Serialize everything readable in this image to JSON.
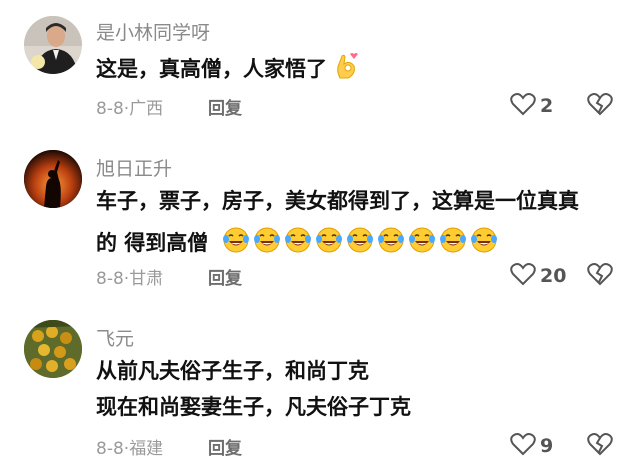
{
  "comments": [
    {
      "username": "是小林同学呀",
      "lines": [
        "这是，真高僧，人家悟了"
      ],
      "date": "8-8",
      "location": "广西",
      "reply_label": "回复",
      "likes": "2",
      "trailing_emoji": "ok-hand-emoji"
    },
    {
      "username": "旭日正升",
      "lines": [
        "车子，票子，房子，美女都得到了，这算是一位真真",
        "的 得到高僧"
      ],
      "date": "8-8",
      "location": "甘肃",
      "reply_label": "回复",
      "likes": "20",
      "trailing_emoji": "laughing-crying-emoji"
    },
    {
      "username": "飞元",
      "lines": [
        "从前凡夫俗子生子，和尚丁克",
        "现在和尚娶妻生子，凡夫俗子丁克"
      ],
      "date": "8-8",
      "location": "福建",
      "reply_label": "回复",
      "likes": "9"
    }
  ],
  "colors": {
    "username": "#8a8a8a",
    "text": "#111111",
    "meta": "#9a9a9a"
  }
}
